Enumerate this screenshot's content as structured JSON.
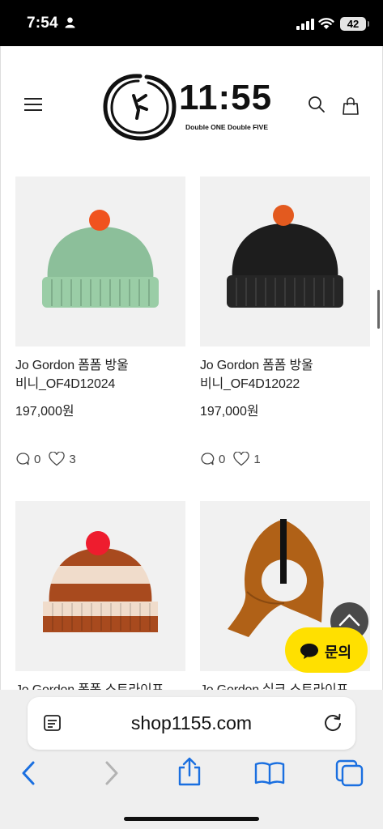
{
  "status_bar": {
    "time": "7:54",
    "battery": "42"
  },
  "header": {
    "logo_text": "11:55",
    "logo_subtitle": "Double ONE Double FIVE"
  },
  "products": [
    {
      "name_line1": "Jo Gordon 폼폼 방울",
      "name_line2": "비니_OF4D12024",
      "price": "197,000원",
      "comments": "0",
      "likes": "3",
      "hat_color": "#8cbf9a",
      "pompom_color": "#f0531e"
    },
    {
      "name_line1": "Jo Gordon 폼폼 방울",
      "name_line2": "비니_OF4D12022",
      "price": "197,000원",
      "comments": "0",
      "likes": "1",
      "hat_color": "#1d1d1d",
      "pompom_color": "#e35a1f"
    },
    {
      "name_line1": "Jo Gordon 폼폼 스트라이프",
      "name_line2": "",
      "price": "",
      "comments": "",
      "likes": "",
      "hat_color": "#a84a1e",
      "pompom_color": "#ee1c2e"
    },
    {
      "name_line1": "Jo Gordon 실크 스트라이프",
      "name_line2": "",
      "price": "",
      "comments": "",
      "likes": "",
      "hat_color": "#b06117",
      "pompom_color": ""
    }
  ],
  "floating": {
    "chat_label": "문의"
  },
  "browser": {
    "url": "shop1155.com"
  },
  "colors": {
    "chat_yellow": "#ffe000",
    "ios_blue": "#1a6fe0"
  }
}
